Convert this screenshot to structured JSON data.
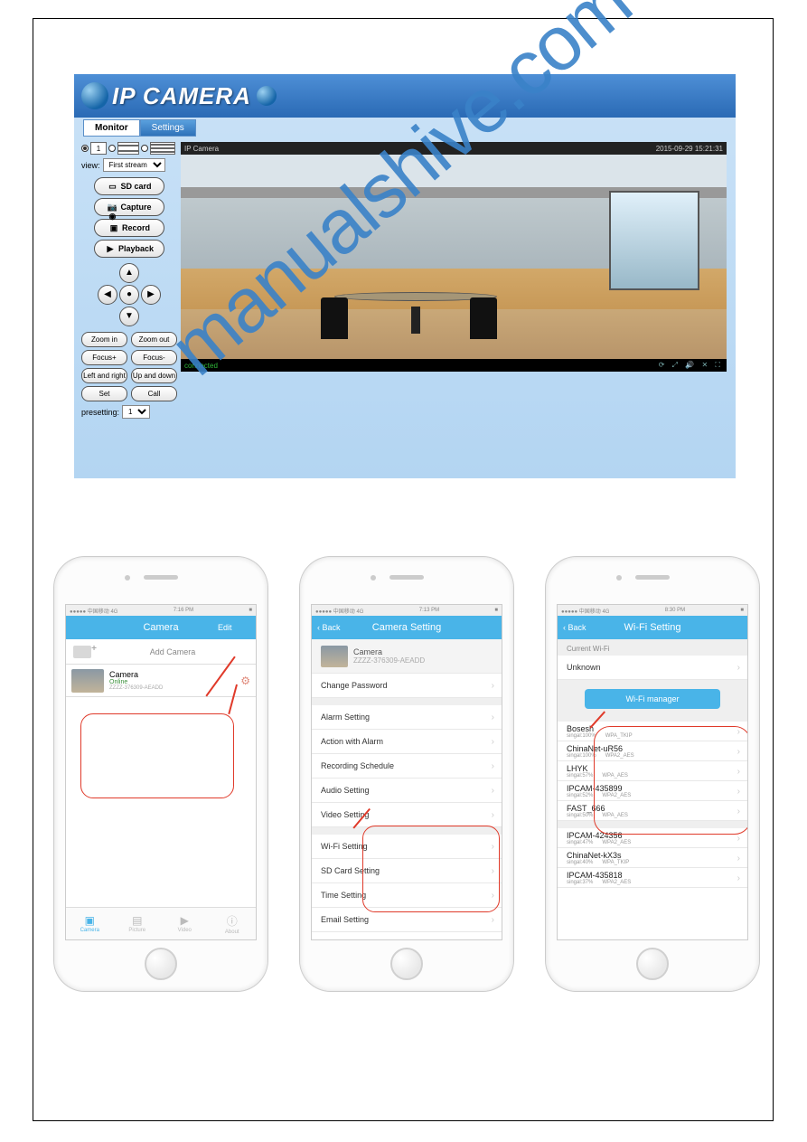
{
  "watermark": "manualshive.com",
  "ip_camera": {
    "brand": "IP CAMERA",
    "tabs": {
      "monitor": "Monitor",
      "settings": "Settings"
    },
    "layout_number": "1",
    "view_label": "view:",
    "view_value": "First stream",
    "buttons": {
      "sdcard": "SD card",
      "capture": "Capture",
      "record": "Record",
      "playback": "Playback"
    },
    "zoom": {
      "in": "Zoom in",
      "out": "Zoom out"
    },
    "focus": {
      "plus": "Focus+",
      "minus": "Focus-"
    },
    "flip": {
      "lr": "Left and right",
      "ud": "Up and down"
    },
    "preset": {
      "set": "Set",
      "call": "Call"
    },
    "presetting_label": "presetting:",
    "presetting_value": "1",
    "feed": {
      "name": "IP Camera",
      "timestamp": "2015-09-29 15:21:31",
      "status": "connected"
    }
  },
  "phone1": {
    "status": {
      "carrier": "●●●●● 中国移动 4G",
      "time": "7:16 PM",
      "batt": "■"
    },
    "nav": {
      "left": "",
      "title": "Camera",
      "right": "Edit"
    },
    "add_camera": "Add Camera",
    "cam": {
      "name": "Camera",
      "status": "Online",
      "id": "ZZZZ-376309-AEADD"
    },
    "tabs": [
      {
        "icon": "▣",
        "label": "Camera"
      },
      {
        "icon": "▤",
        "label": "Picture"
      },
      {
        "icon": "▶",
        "label": "Video"
      },
      {
        "icon": "ⓘ",
        "label": "About"
      }
    ]
  },
  "phone2": {
    "status": {
      "carrier": "●●●●● 中国移动 4G",
      "time": "7:13 PM",
      "batt": "■"
    },
    "nav": {
      "left": "‹ Back",
      "title": "Camera Setting",
      "right": ""
    },
    "cam": {
      "name": "Camera",
      "id": "ZZZZ-376309-AEADD"
    },
    "rows": [
      "Change Password",
      "Alarm Setting",
      "Action with Alarm",
      "Recording Schedule",
      "Audio Setting",
      "Video Setting",
      "Wi-Fi Setting",
      "SD Card Setting",
      "Time Setting",
      "Email Setting"
    ]
  },
  "phone3": {
    "status": {
      "carrier": "●●●●● 中国移动 4G",
      "time": "8:30 PM",
      "batt": "■"
    },
    "nav": {
      "left": "‹ Back",
      "title": "Wi-Fi Setting",
      "right": ""
    },
    "current_label": "Current Wi-Fi",
    "current_value": "Unknown",
    "manager_btn": "Wi-Fi manager",
    "networks": [
      {
        "name": "Bosesh",
        "signal": "singal:100%",
        "sec": "WPA_TKIP"
      },
      {
        "name": "ChinaNet-uR56",
        "signal": "singal:100%",
        "sec": "WPA2_AES"
      },
      {
        "name": "LHYK",
        "signal": "singal:57%",
        "sec": "WPA_AES"
      },
      {
        "name": "IPCAM-435899",
        "signal": "singal:52%",
        "sec": "WPA2_AES"
      },
      {
        "name": "FAST_666",
        "signal": "singal:50%",
        "sec": "WPA_AES"
      },
      {
        "name": "IPCAM-424356",
        "signal": "singal:47%",
        "sec": "WPA2_AES"
      },
      {
        "name": "ChinaNet-kX3s",
        "signal": "singal:40%",
        "sec": "WPA_TKIP"
      },
      {
        "name": "IPCAM-435818",
        "signal": "singal:37%",
        "sec": "WPA2_AES"
      }
    ]
  }
}
